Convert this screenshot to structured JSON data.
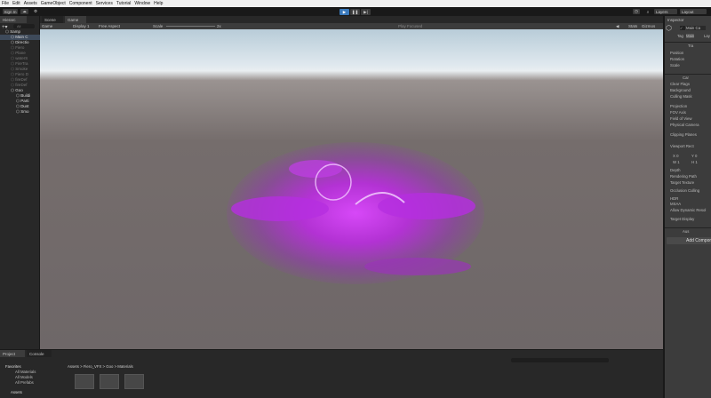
{
  "menu": [
    "File",
    "Edit",
    "Assets",
    "GameObject",
    "Component",
    "Services",
    "Tutorial",
    "Window",
    "Help"
  ],
  "toolbar": {
    "sign_in": "Sign In",
    "layers": "Layers",
    "layout": "Layout"
  },
  "hierarchy": {
    "tab": "Hierarc",
    "search_placeholder": "All",
    "items": [
      {
        "label": "Samp",
        "indent": 0,
        "dim": false,
        "sel": false
      },
      {
        "label": "Main C",
        "indent": 1,
        "dim": false,
        "sel": true
      },
      {
        "label": "Directio",
        "indent": 1,
        "dim": false,
        "sel": false
      },
      {
        "label": "Fiero",
        "indent": 1,
        "dim": true,
        "sel": false
      },
      {
        "label": "Plane",
        "indent": 1,
        "dim": true,
        "sel": false
      },
      {
        "label": "waterS",
        "indent": 1,
        "dim": true,
        "sel": false
      },
      {
        "label": "FireTra",
        "indent": 1,
        "dim": true,
        "sel": false
      },
      {
        "label": "Smoke",
        "indent": 1,
        "dim": true,
        "sel": false
      },
      {
        "label": "Fiero D",
        "indent": 1,
        "dim": true,
        "sel": false
      },
      {
        "label": "fireDef",
        "indent": 1,
        "dim": true,
        "sel": false
      },
      {
        "label": "fireDef",
        "indent": 1,
        "dim": true,
        "sel": false
      },
      {
        "label": "Goo",
        "indent": 1,
        "dim": false,
        "sel": false
      },
      {
        "label": "Buildi",
        "indent": 2,
        "dim": false,
        "sel": false
      },
      {
        "label": "Parti",
        "indent": 2,
        "dim": false,
        "sel": false
      },
      {
        "label": "Dust",
        "indent": 2,
        "dim": false,
        "sel": false
      },
      {
        "label": "Smo",
        "indent": 2,
        "dim": false,
        "sel": false
      }
    ]
  },
  "game": {
    "tabs": [
      "Scene",
      "Game"
    ],
    "mode": "Game",
    "display": "Display 1",
    "aspect": "Free Aspect",
    "scale_label": "Scale",
    "scale_value": "2x",
    "play_focused": "Play Focused",
    "stats": "Stats",
    "gizmos": "Gizmos"
  },
  "inspector": {
    "tab": "Inspector",
    "object_name": "Main Ca",
    "tag_label": "Tag",
    "tag_value": "Main",
    "layer_label": "Lay",
    "transform": "Tra",
    "camera": "Car",
    "audio": "Aus",
    "transform_fields": [
      "Position",
      "Rotation",
      "Scale"
    ],
    "camera_fields": [
      "Clear Flags",
      "Background",
      "Culling Mask",
      "Projection",
      "FOV Axis",
      "Field of View",
      "Physical Camera",
      "Clipping Planes",
      "Viewport Rect",
      "Depth",
      "Rendering Path",
      "Target Texture",
      "Occlusion Culling",
      "HDR",
      "MSAA",
      "Allow Dynamic Resol",
      "Target Display"
    ],
    "viewport": {
      "x": "0",
      "y": "0",
      "w": "1",
      "h": "1"
    },
    "add_component": "Add Compone"
  },
  "bottom": {
    "tabs": [
      "Project",
      "Console"
    ],
    "favorites": "Favorites",
    "fav_items": [
      "All Materials",
      "All Models",
      "All Prefabs"
    ],
    "assets": "Assets",
    "breadcrumb": [
      "Assets",
      "Fiero_VFX",
      "Goo",
      "Materials"
    ]
  },
  "colors": {
    "accent": "#3a79bb",
    "vfx": "#c83cf0"
  }
}
